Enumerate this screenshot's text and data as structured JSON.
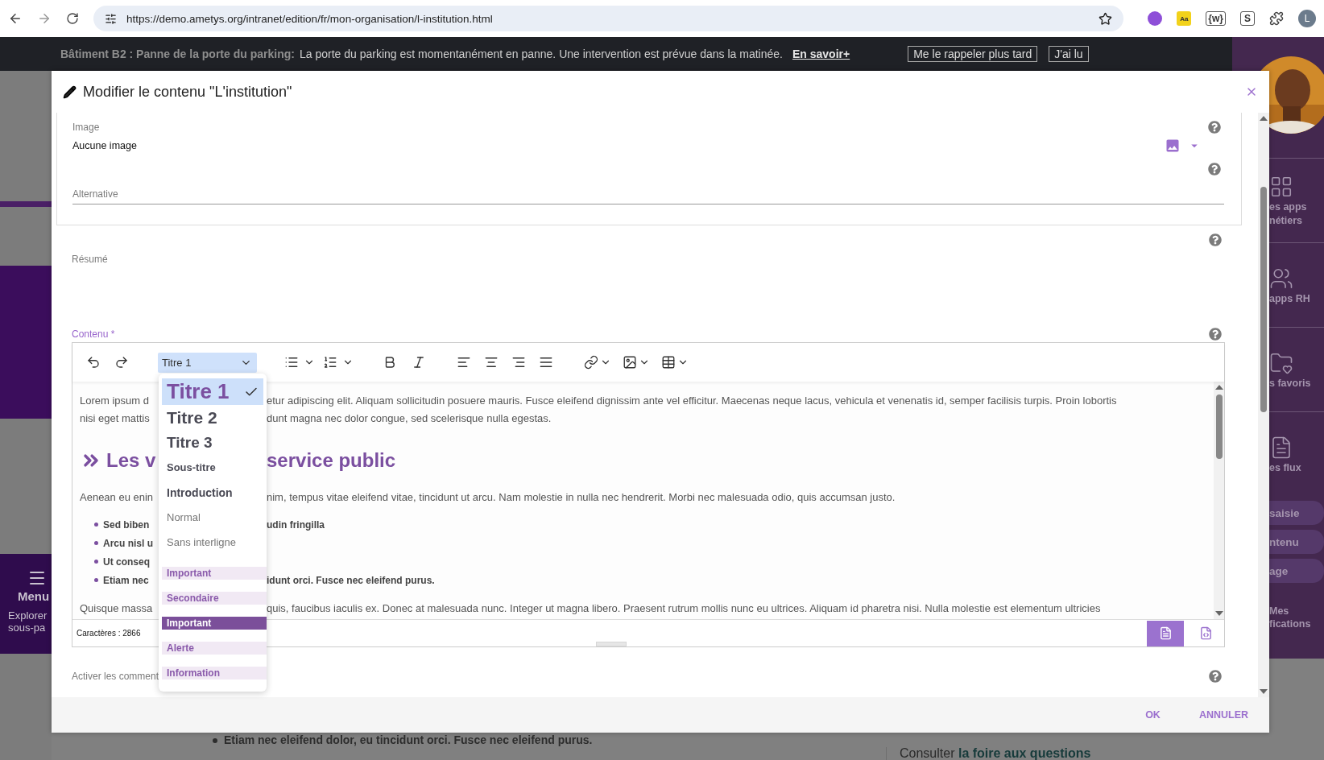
{
  "browser": {
    "url": "https://demo.ametys.org/intranet/edition/fr/mon-organisation/l-institution.html",
    "extensions": [
      {
        "kind": "orb"
      },
      {
        "kind": "badge",
        "label": "Aa"
      },
      {
        "kind": "outline",
        "label": "{w}"
      },
      {
        "kind": "outline",
        "label": "S"
      }
    ],
    "profile": "L"
  },
  "banner": {
    "title": "Bâtiment B2 : Panne de la porte du parking:",
    "message": "La porte du parking est momentanément en panne. Une intervention est prévue dans la matinée.",
    "link": "En savoir+",
    "buttons": [
      "Me le rappeler plus tard",
      "J'ai lu"
    ]
  },
  "left_menu": {
    "label": "Menu",
    "hint": [
      "Explorer",
      "sous-pa"
    ]
  },
  "sidebar": {
    "items": [
      {
        "kind": "grid",
        "lines": [
          "es apps",
          "nétiers"
        ]
      },
      {
        "kind": "people",
        "lines": [
          "apps RH"
        ]
      },
      {
        "kind": "folder",
        "lines": [
          "s favoris"
        ]
      },
      {
        "kind": "document",
        "lines": [
          "es flux"
        ]
      }
    ],
    "pills": [
      "saisie",
      "ntenu",
      "age"
    ],
    "notifications": [
      "Mes",
      "fications"
    ]
  },
  "page": {
    "bullet": "Etiam nec eleifend dolor, eu tincidunt orci. Fusce nec eleifend purus.",
    "faq_prefix": "Consulter",
    "faq_link": "la foire aux questions"
  },
  "dialog": {
    "title": "Modifier le contenu \"L'institution\"",
    "image": {
      "label": "Image",
      "value": "Aucune image",
      "alternative": "Alternative"
    },
    "summary": {
      "label": "Résumé"
    },
    "content": {
      "label": "Contenu *",
      "style": "Titre 1",
      "style_menu": [
        {
          "label": "Titre 1",
          "kind": "h1",
          "selected": true
        },
        {
          "label": "Titre 2",
          "kind": "h2",
          "selected": false
        },
        {
          "label": "Titre 3",
          "kind": "h3",
          "selected": false
        },
        {
          "label": "Sous-titre",
          "kind": "subtitle",
          "selected": false
        },
        {
          "label": "Introduction",
          "kind": "intro",
          "selected": false
        },
        {
          "label": "Normal",
          "kind": "normal",
          "selected": false
        },
        {
          "label": "Sans interligne",
          "kind": "normal",
          "selected": false
        },
        {
          "label": "Important",
          "kind": "tag",
          "selected": false
        },
        {
          "label": "Secondaire",
          "kind": "tag",
          "selected": false
        },
        {
          "label": "Important",
          "kind": "tag-strong",
          "selected": false
        },
        {
          "label": "Alerte",
          "kind": "tag",
          "selected": false
        },
        {
          "label": "Information",
          "kind": "tag",
          "selected": false
        }
      ],
      "rows": [
        {
          "kind": "paragraph",
          "left": "Lorem ipsum d",
          "right": "etur adipiscing elit. Aliquam sollicitudin posuere mauris. Fusce eleifend dignissim ante vel efficitur. Maecenas neque lacus, vehicula et venenatis id, semper facilisis turpis. Proin lobortis"
        },
        {
          "kind": "line",
          "left": "nisi eget mattis",
          "right": "dunt magna nec dolor congue, sed scelerisque nulla egestas."
        },
        {
          "kind": "heading",
          "left": "Les v",
          "right": "service public"
        },
        {
          "kind": "paragraph",
          "left": "Aenean eu enin",
          "right": "nim, tempus vitae eleifend vitae, tincidunt ut arcu. Nam molestie in nulla nec hendrerit. Morbi nec malesuada odio, quis accumsan justo."
        },
        {
          "kind": "bullet",
          "left": "Sed biben",
          "right": "udin fringilla"
        },
        {
          "kind": "bullet",
          "left": "Arcu nisl u"
        },
        {
          "kind": "bullet",
          "left": "Ut conseq"
        },
        {
          "kind": "bullet",
          "left": "Etiam nec",
          "right": "idunt orci. Fusce nec eleifend purus."
        },
        {
          "kind": "paragraph",
          "left": "Quisque massa",
          "right": "quis, faucibus iaculis ex. Donec at malesuada nunc. Integer ut magna libero. Praesent rutrum mollis nunc eu ultrices. Aliquam id pharetra nisi. Nulla molestie est elementum ultricies"
        }
      ],
      "char_count": "Caractères : 2866",
      "modes": [
        {
          "kind": "wysiwyg",
          "selected": true
        },
        {
          "kind": "source",
          "selected": false
        }
      ]
    },
    "comments": {
      "label": "Activer les comment"
    },
    "buttons": [
      "OK",
      "ANNULER"
    ]
  }
}
